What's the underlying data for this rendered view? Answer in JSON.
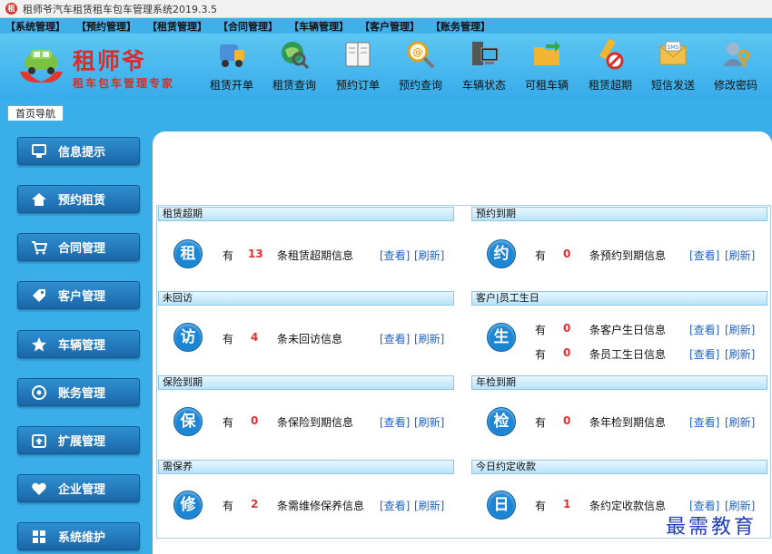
{
  "window": {
    "title": "租师爷汽车租赁租车包车管理系统2019.3.5",
    "logo_char": "租"
  },
  "menu": [
    "【系统管理】",
    "【预约管理】",
    "【租赁管理】",
    "【合同管理】",
    "【车辆管理】",
    "【客户管理】",
    "【账务管理】"
  ],
  "brand": {
    "name": "租师爷",
    "slogan": "租车包车管理专家"
  },
  "toolbar": [
    "租赁开单",
    "租赁查询",
    "预约订单",
    "预约查询",
    "车辆状态",
    "可租车辆",
    "租赁超期",
    "短信发送",
    "修改密码"
  ],
  "tab": "首页导航",
  "sidebar": [
    "信息提示",
    "预约租赁",
    "合同管理",
    "客户管理",
    "车辆管理",
    "账务管理",
    "扩展管理",
    "企业管理",
    "系统维护"
  ],
  "sections": {
    "lease_overdue": {
      "title": "租赁超期",
      "badge": "租",
      "has": "有",
      "count": "13",
      "text": "条租赁超期信息",
      "view": "[查看]",
      "refresh": "[刷新]"
    },
    "booking_due": {
      "title": "预约到期",
      "badge": "约",
      "has": "有",
      "count": "0",
      "text": "条预约到期信息",
      "view": "[查看]",
      "refresh": "[刷新]"
    },
    "not_visited": {
      "title": "未回访",
      "badge": "访",
      "has": "有",
      "count": "4",
      "text": "条未回访信息",
      "view": "[查看]",
      "refresh": "[刷新]"
    },
    "birthday": {
      "title": "客户|员工生日",
      "badge": "生",
      "has": "有",
      "count1": "0",
      "text1": "条客户生日信息",
      "count2": "0",
      "text2": "条员工生日信息",
      "view": "[查看]",
      "refresh": "[刷新]"
    },
    "insurance_due": {
      "title": "保险到期",
      "badge": "保",
      "has": "有",
      "count": "0",
      "text": "条保险到期信息",
      "view": "[查看]",
      "refresh": "[刷新]"
    },
    "inspection_due": {
      "title": "年检到期",
      "badge": "检",
      "has": "有",
      "count": "0",
      "text": "条年检到期信息",
      "view": "[查看]",
      "refresh": "[刷新]"
    },
    "maintenance": {
      "title": "需保养",
      "badge": "修",
      "has": "有",
      "count": "2",
      "text": "条需维修保养信息",
      "view": "[查看]",
      "refresh": "[刷新]"
    },
    "collection_today": {
      "title": "今日约定收款",
      "badge": "日",
      "has": "有",
      "count": "1",
      "text": "条约定收款信息",
      "view": "[查看]",
      "refresh": "[刷新]"
    }
  },
  "watermark": "最需教育"
}
